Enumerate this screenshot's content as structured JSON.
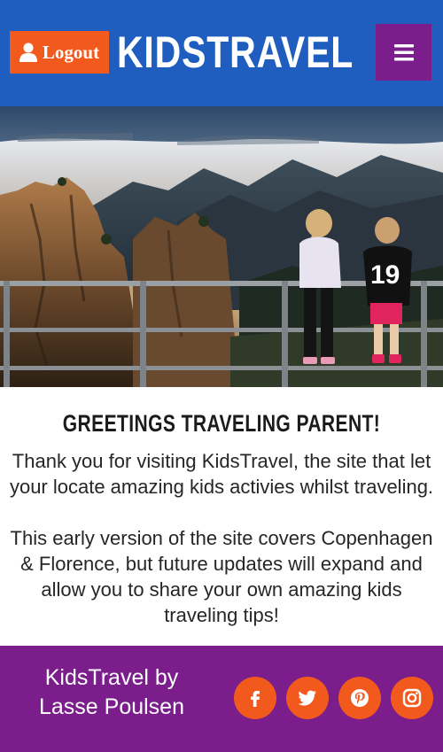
{
  "header": {
    "logout_label": "Logout",
    "brand": "KIDSTRAVEL",
    "menu_icon": "hamburger-icon",
    "colors": {
      "background": "#1f5dbf",
      "logout": "#f25a1d",
      "menu": "#7b1e8c"
    }
  },
  "hero": {
    "image": "two-children-at-mountain-railing",
    "shirt_number": "19"
  },
  "main": {
    "heading": "GREETINGS TRAVELING PARENT!",
    "paragraph_1": "Thank you for visiting KidsTravel, the site that let your locate amazing kids activies whilst traveling.",
    "paragraph_2": "This early version of the site covers Copenhagen & Florence, but future updates will expand and allow you to share your own amazing kids traveling tips!"
  },
  "footer": {
    "credit_line1": "KidsTravel by",
    "credit_line2": "Lasse Poulsen",
    "social": [
      "facebook-icon",
      "twitter-icon",
      "pinterest-icon",
      "instagram-icon"
    ],
    "colors": {
      "background": "#7b1e8c",
      "icon_bg": "#f25a1d"
    }
  }
}
